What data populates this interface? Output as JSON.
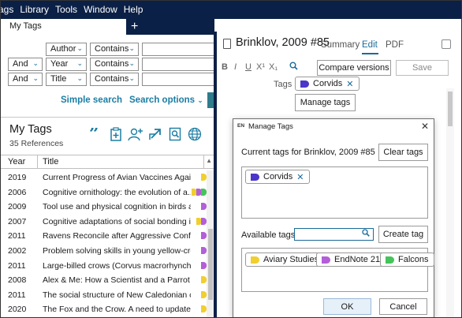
{
  "menubar": {
    "items": [
      "ags",
      "Library",
      "Tools",
      "Window",
      "Help"
    ]
  },
  "tabs": {
    "active_label": "My Tags",
    "add_label": "+"
  },
  "search": {
    "rows": [
      {
        "connector": "",
        "field": "Author",
        "operator": "Contains",
        "value": ""
      },
      {
        "connector": "And",
        "field": "Year",
        "operator": "Contains",
        "value": ""
      },
      {
        "connector": "And",
        "field": "Title",
        "operator": "Contains",
        "value": ""
      }
    ],
    "simple_search_label": "Simple search",
    "search_options_label": "Search options"
  },
  "library": {
    "title": "My Tags",
    "subtitle": "35 References",
    "icons": [
      "quote-icon",
      "insert-citation-icon",
      "add-user-icon",
      "share-arrow-icon",
      "find-pdf-icon",
      "web-globe-icon"
    ],
    "columns": [
      "Year",
      "Title"
    ],
    "rows": [
      {
        "year": "2019",
        "title": "Current Progress of Avian Vaccines Against ...",
        "tags": [
          "#f0cf2e"
        ]
      },
      {
        "year": "2006",
        "title": "Cognitive ornithology: the evolution of a...",
        "tags": [
          "#f0cf2e",
          "#b35fd8",
          "#45c45a"
        ]
      },
      {
        "year": "2009",
        "title": "Tool use and physical cognition in birds and...",
        "tags": [
          "#b35fd8"
        ]
      },
      {
        "year": "2007",
        "title": "Cognitive adaptations of social bonding i...",
        "tags": [
          "#f0cf2e",
          "#b35fd8"
        ]
      },
      {
        "year": "2011",
        "title": "Ravens Reconcile after Aggressive Conflicts ...",
        "tags": [
          "#b35fd8"
        ]
      },
      {
        "year": "2002",
        "title": "Problem solving skills in young yellow-crow...",
        "tags": [
          "#b35fd8"
        ]
      },
      {
        "year": "2011",
        "title": "Large-billed crows (Corvus macrorhynchos) ...",
        "tags": [
          "#b35fd8"
        ]
      },
      {
        "year": "2008",
        "title": "Alex & Me: How a Scientist and a Parrot Dis...",
        "tags": [
          "#f0cf2e"
        ]
      },
      {
        "year": "2011",
        "title": "The social structure of New Caledonian crows",
        "tags": [
          "#f0cf2e"
        ]
      },
      {
        "year": "2020",
        "title": "The Fox and the Crow. A need to update pe...",
        "tags": [
          "#f0cf2e"
        ]
      }
    ]
  },
  "reference": {
    "title": "Brinklov, 2009 #85",
    "view_tabs": [
      "Summary",
      "Edit",
      "PDF"
    ],
    "active_view": "Edit",
    "format": {
      "bold": "B",
      "italic": "I",
      "underline": "U",
      "superscript": "X¹",
      "subscript": "X₁",
      "find": "🔍"
    },
    "compare_label": "Compare versions",
    "save_label": "Save",
    "tags_label": "Tags",
    "tag": {
      "name": "Corvids",
      "color": "#4a36c9",
      "remove": "✕"
    },
    "manage_tags_label": "Manage tags"
  },
  "dialog": {
    "icon_text": "EN",
    "title": "Manage Tags",
    "close": "✕",
    "current_label": "Current tags for Brinklov, 2009 #85",
    "clear_label": "Clear tags",
    "current_tags": [
      {
        "name": "Corvids",
        "color": "#4a36c9",
        "remove": "✕"
      }
    ],
    "available_label": "Available tags",
    "search_value": "",
    "create_label": "Create tag",
    "available_tags": [
      {
        "name": "Aviary Studies",
        "color": "#f0cf2e"
      },
      {
        "name": "EndNote 21",
        "color": "#b35fd8"
      },
      {
        "name": "Falcons",
        "color": "#45c45a"
      }
    ],
    "ok_label": "OK",
    "cancel_label": "Cancel"
  },
  "colors": {
    "navy": "#0b2046",
    "accent": "#1b7da3",
    "link": "#1b6a9a"
  }
}
